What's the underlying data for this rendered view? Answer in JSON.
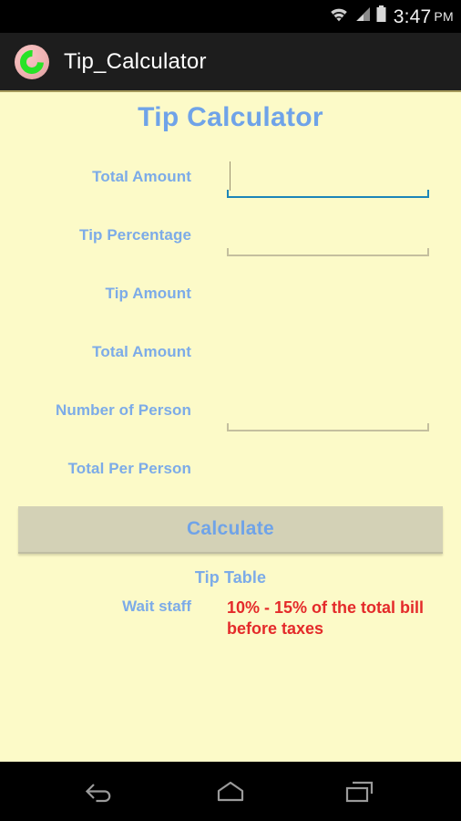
{
  "statusbar": {
    "time": "3:47",
    "ampm": "PM",
    "icons": [
      "wifi-icon",
      "cellular-signal-icon",
      "battery-icon"
    ]
  },
  "appbar": {
    "icon": "app-logo-icon",
    "title": "Tip_Calculator"
  },
  "screen": {
    "title": "Tip Calculator",
    "background_color": "#fcfac8",
    "label_color": "#7cabe8",
    "accent_color": "#6fa3e8",
    "focus_color": "#1d85b8",
    "alert_color": "#e42a2a"
  },
  "form": {
    "rows": [
      {
        "label": "Total Amount",
        "has_input": true,
        "value": "",
        "focused": true
      },
      {
        "label": "Tip Percentage",
        "has_input": true,
        "value": "",
        "focused": false
      },
      {
        "label": "Tip Amount",
        "has_input": false,
        "value": "",
        "focused": false
      },
      {
        "label": "Total Amount",
        "has_input": false,
        "value": "",
        "focused": false
      },
      {
        "label": "Number of Person",
        "has_input": true,
        "value": "",
        "focused": false
      },
      {
        "label": "Total Per Person",
        "has_input": false,
        "value": "",
        "focused": false
      }
    ]
  },
  "button": {
    "calculate_label": "Calculate"
  },
  "tip_table": {
    "title": "Tip Table",
    "rows": [
      {
        "label": "Wait staff",
        "value": "10% - 15% of the total bill before taxes"
      }
    ]
  },
  "navbar": {
    "buttons": [
      {
        "name": "back-icon"
      },
      {
        "name": "home-icon"
      },
      {
        "name": "recents-icon"
      }
    ]
  }
}
